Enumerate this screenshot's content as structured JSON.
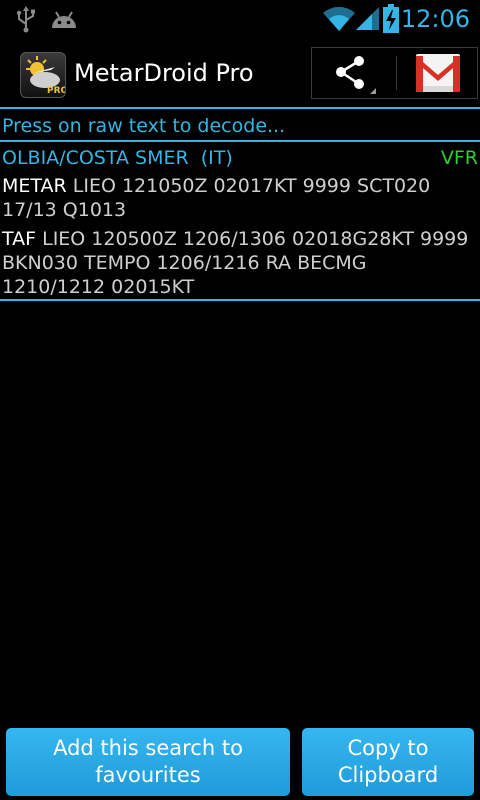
{
  "status_bar": {
    "time": "12:06",
    "icons": [
      "usb-icon",
      "android-icon",
      "wifi-icon",
      "signal-icon",
      "battery-charging-icon"
    ]
  },
  "action_bar": {
    "title": "MetarDroid Pro",
    "app_icon_badge": "PRO",
    "actions": [
      "share-icon",
      "gmail-icon"
    ]
  },
  "content": {
    "hint": "Press on raw text to decode...",
    "station": {
      "name": "OLBIA/COSTA SMER  (IT)",
      "flight_category": "VFR"
    },
    "metar": {
      "kind": "METAR",
      "text": " LIEO 121050Z 02017KT 9999 SCT020 17/13 Q1013"
    },
    "taf": {
      "kind": "TAF",
      "text": " LIEO 120500Z 1206/1306 02018G28KT 9999 BKN030 TEMPO 1206/1216 RA BECMG 1210/1212 02015KT"
    }
  },
  "buttons": {
    "add_favourites": "Add this search to favourites",
    "copy_clipboard": "Copy to Clipboard"
  },
  "colors": {
    "accent": "#33b5e5",
    "vfr": "#33cc33",
    "button": "#2aa8e6"
  }
}
